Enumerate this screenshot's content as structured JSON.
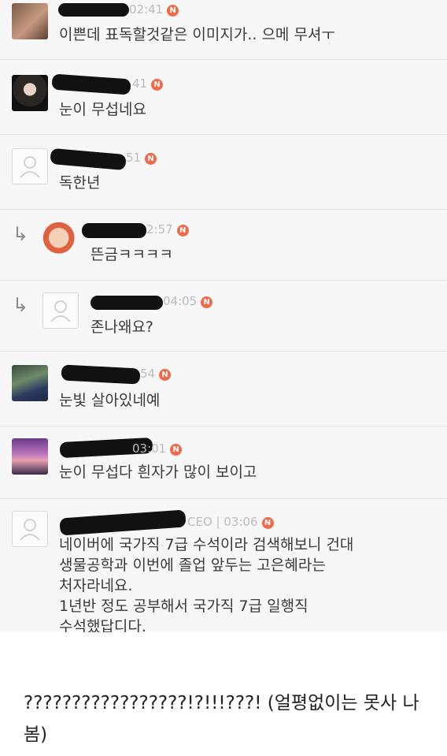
{
  "comments": [
    {
      "time": "02:41",
      "badge": "N",
      "text": [
        "이쁜데 표독할것같은 이미지가.. 으메 무셔ㅜ"
      ]
    },
    {
      "time": "41",
      "badge": "N",
      "text": [
        "눈이 무섭네요"
      ]
    },
    {
      "time": "51",
      "badge": "N",
      "text": [
        "독한년"
      ]
    },
    {
      "time": "2:57",
      "badge": "N",
      "text": [
        "뜬금ㅋㅋㅋㅋ"
      ]
    },
    {
      "time": "04:05",
      "badge": "N",
      "text": [
        "존나왜요?"
      ]
    },
    {
      "time": "54",
      "badge": "N",
      "text": [
        "눈빛 살아있네예"
      ]
    },
    {
      "time": "03:01",
      "badge": "N",
      "text": [
        "눈이 무섭다 흰자가 많이 보이고"
      ]
    },
    {
      "role": "CEO",
      "time": "03:06",
      "badge": "N",
      "text": [
        "네이버에 국가직 7급 수석이라 검색해보니 건대",
        "생물공학과 이번에 졸업 앞두는 고은혜라는",
        "처자라네요.",
        "1년반 정도 공부해서 국가직 7급 일행직",
        "수석했답디다."
      ]
    }
  ],
  "caption": "?????????????????!?!!!???! (얼평없이는 못사 나봄)",
  "colors": {
    "badge": "#f06a4a",
    "meta": "#bcbcbc",
    "background": "#f7f7f7"
  }
}
